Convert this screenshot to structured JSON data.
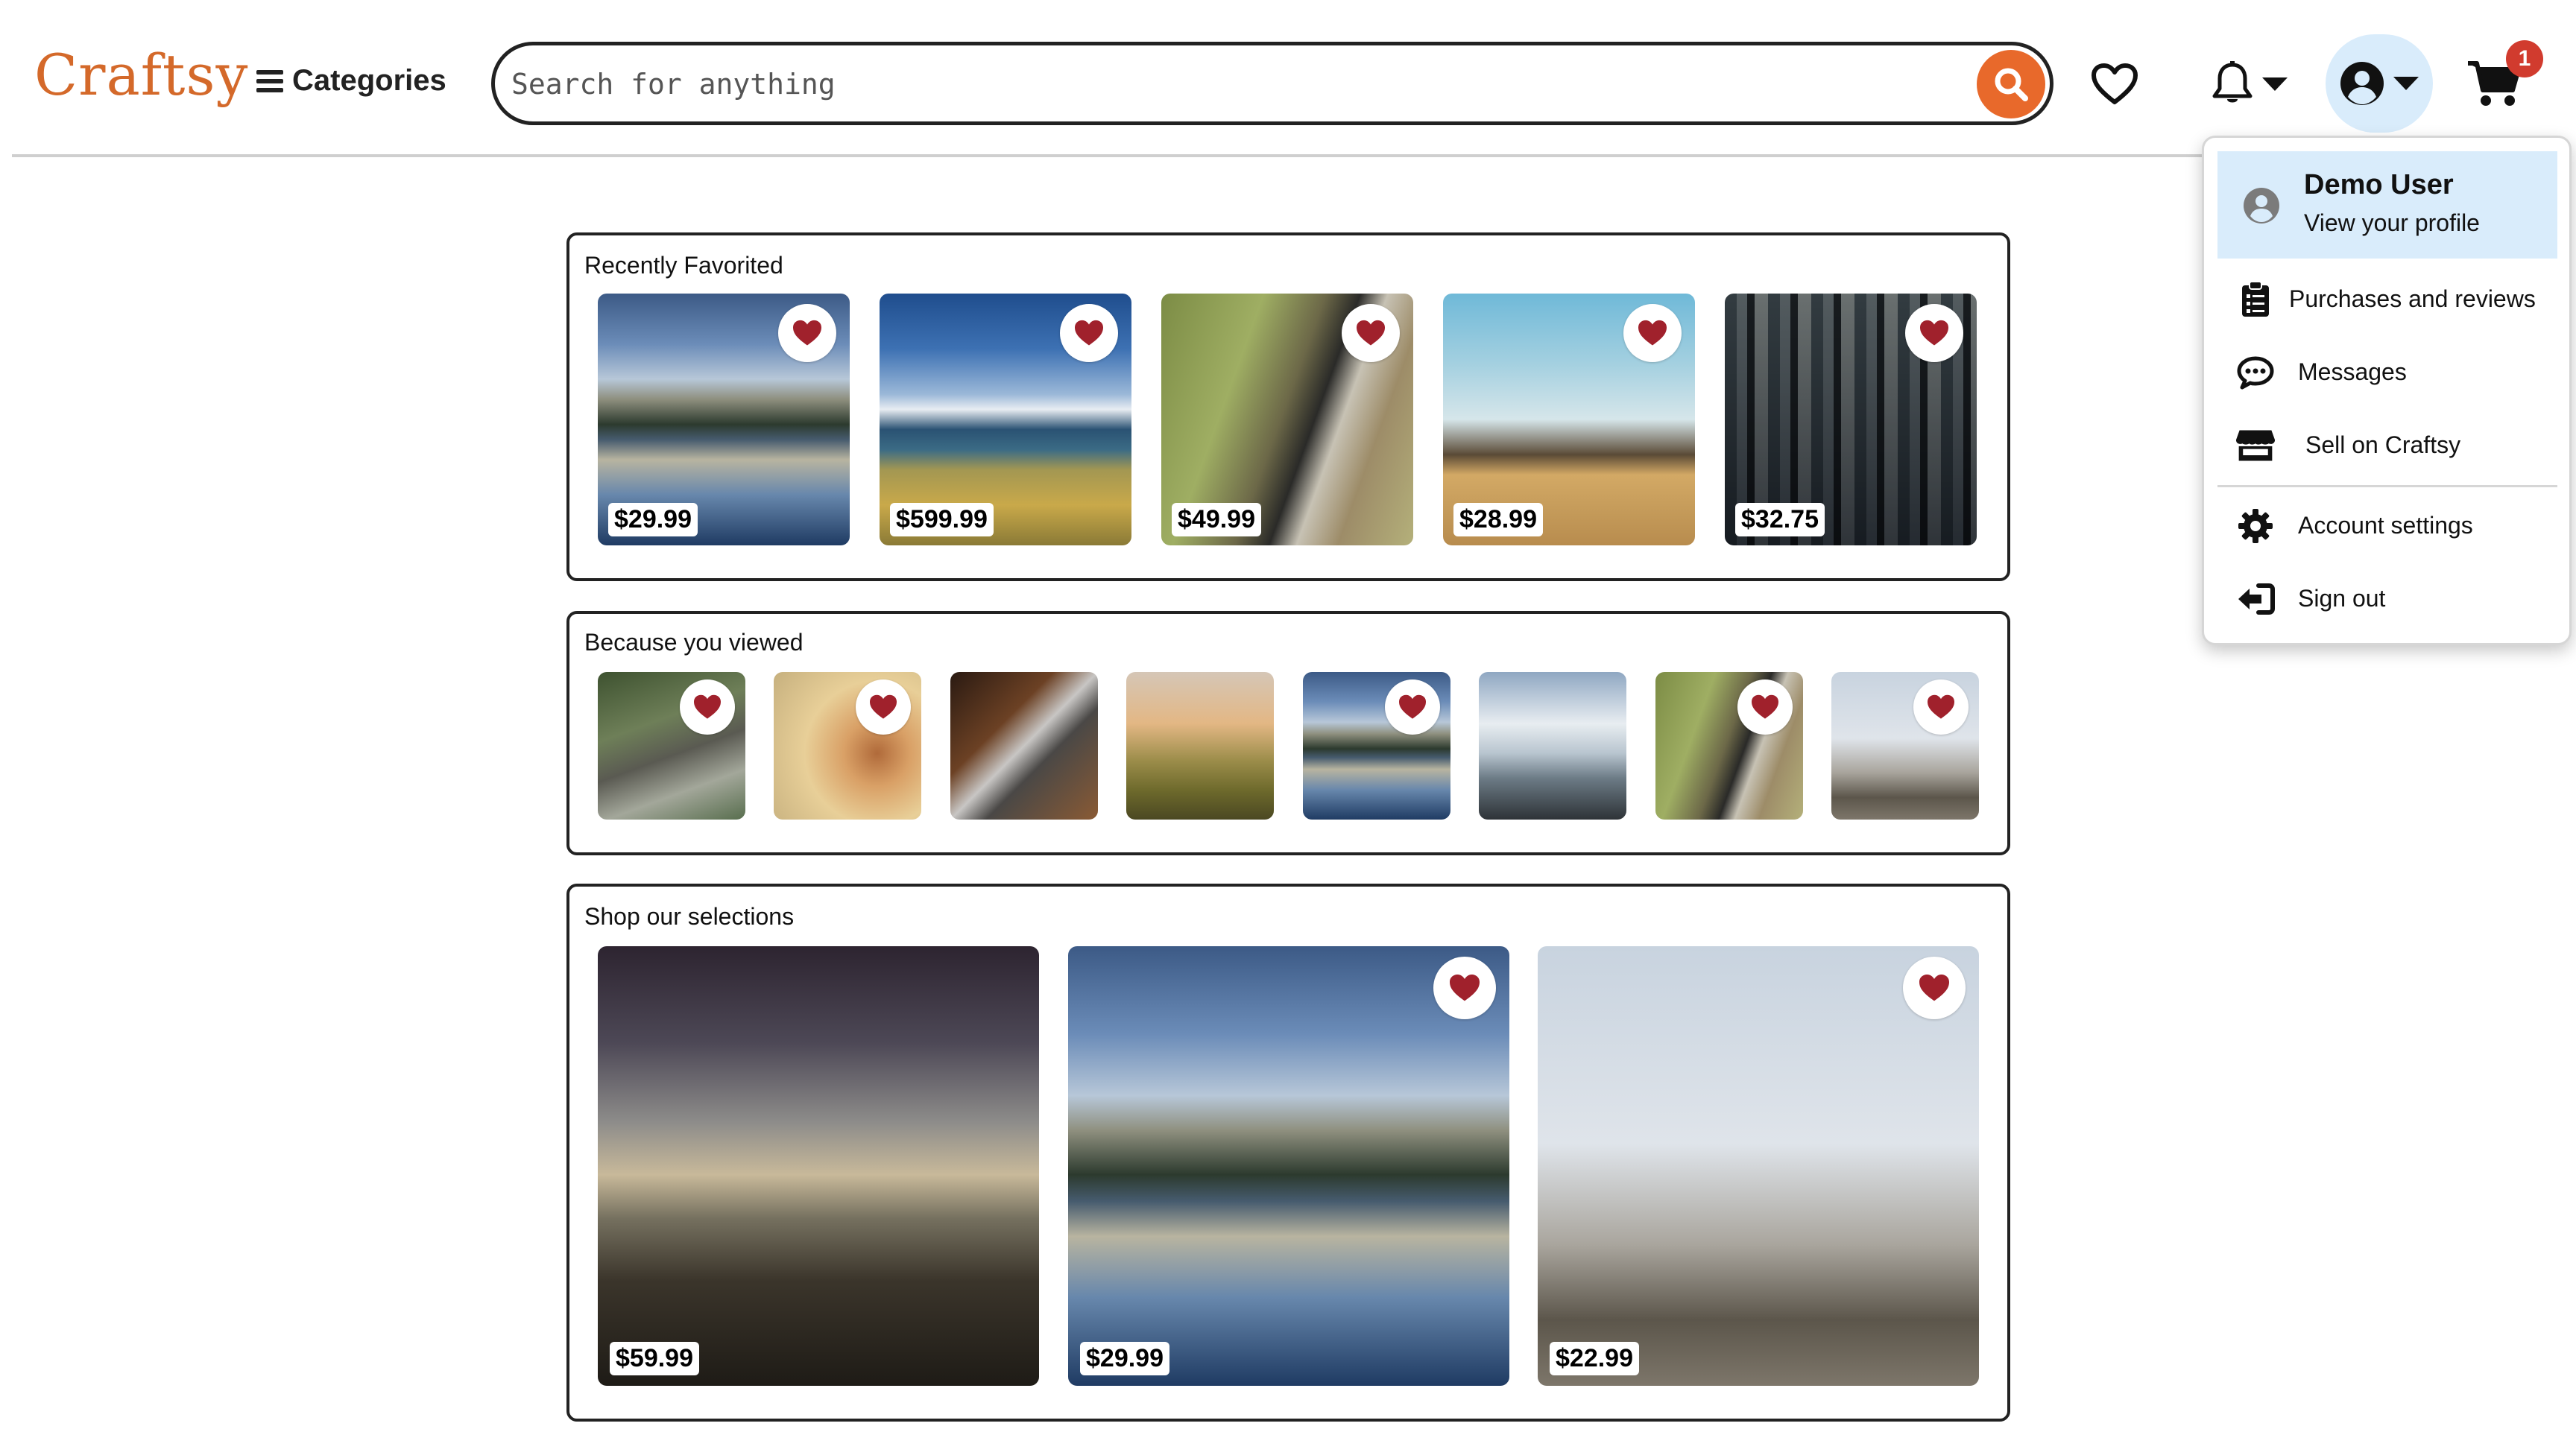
{
  "header": {
    "logo": "Craftsy",
    "categories_label": "Categories",
    "search_placeholder": "Search for anything",
    "cart_count": "1"
  },
  "account_menu": {
    "user_name": "Demo User",
    "profile_link": "View your profile",
    "items": [
      {
        "label": "Purchases and reviews",
        "icon": "clipboard-icon"
      },
      {
        "label": "Messages",
        "icon": "chat-bubble-icon"
      },
      {
        "label": "Sell on Craftsy",
        "icon": "storefront-icon"
      },
      {
        "label": "Account settings",
        "icon": "gear-icon"
      },
      {
        "label": "Sign out",
        "icon": "sign-out-icon"
      }
    ]
  },
  "sections": {
    "recently_favorited": {
      "title": "Recently Favorited",
      "items": [
        {
          "price": "$29.99"
        },
        {
          "price": "$599.99"
        },
        {
          "price": "$49.99"
        },
        {
          "price": "$28.99"
        },
        {
          "price": "$32.75"
        }
      ]
    },
    "because_you_viewed": {
      "title": "Because you viewed"
    },
    "shop_selections": {
      "title": "Shop our selections",
      "items": [
        {
          "price": "$59.99"
        },
        {
          "price": "$29.99"
        },
        {
          "price": "$22.99"
        }
      ]
    }
  },
  "colors": {
    "brand": "#d4692a",
    "search_button": "#e8692b",
    "heart": "#a0212c",
    "account_highlight": "#d9ecfb",
    "badge": "#d13b2e"
  }
}
